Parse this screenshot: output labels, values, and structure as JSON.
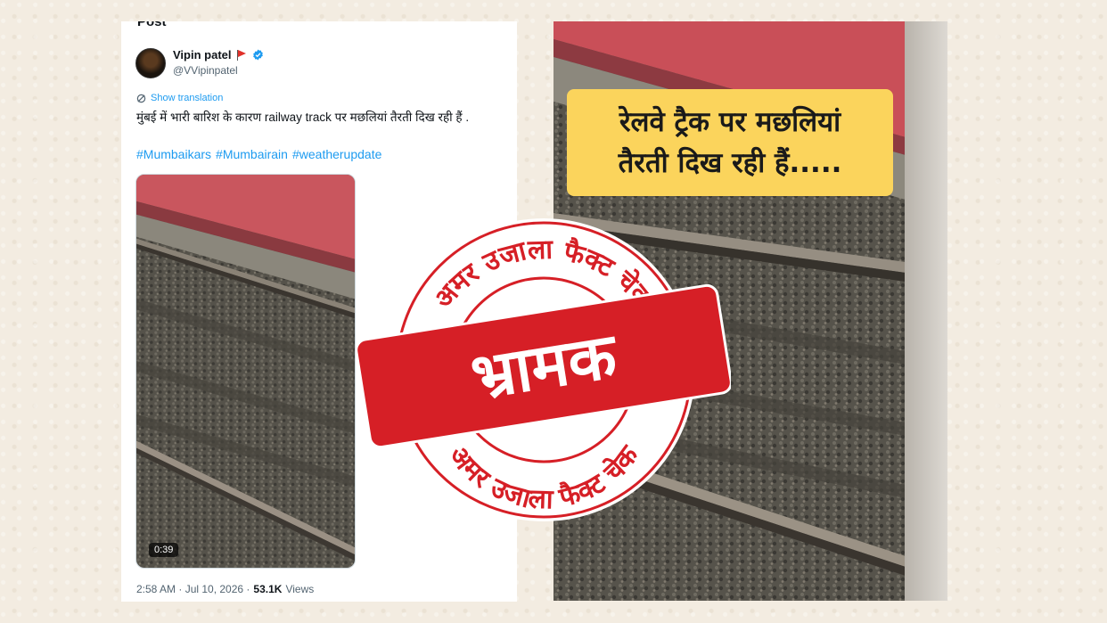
{
  "tweet": {
    "header": "Post",
    "author_name": "Vipin patel",
    "author_handle": "@VVipinpatel",
    "translation_link": "Show translation",
    "text": "मुंबई में भारी बारिश के कारण railway track पर मछलियां तैरती दिख रही हैं .",
    "hashtags": [
      "#Mumbaikars",
      "#Mumbairain",
      "#weatherupdate"
    ],
    "video_duration": "0:39",
    "time": "2:58 AM · Jul 10, 2026 ·",
    "views_count": "53.1K",
    "views_label": "Views"
  },
  "headline": {
    "line1": "रेलवे ट्रैक पर मछलियां",
    "line2": "तैरती दिख रही हैं....."
  },
  "stamp": {
    "top_text": "अमर उजाला फैक्ट चेक",
    "bottom_text": "अमर उजाला फैक्ट चेक",
    "verdict": "भ्रामक"
  },
  "colors": {
    "stamp_red": "#d61f26",
    "headline_bg": "#fbd45c",
    "link_blue": "#1d9bf0"
  },
  "icons": [
    "flag-icon",
    "verified-icon",
    "translate-icon"
  ]
}
